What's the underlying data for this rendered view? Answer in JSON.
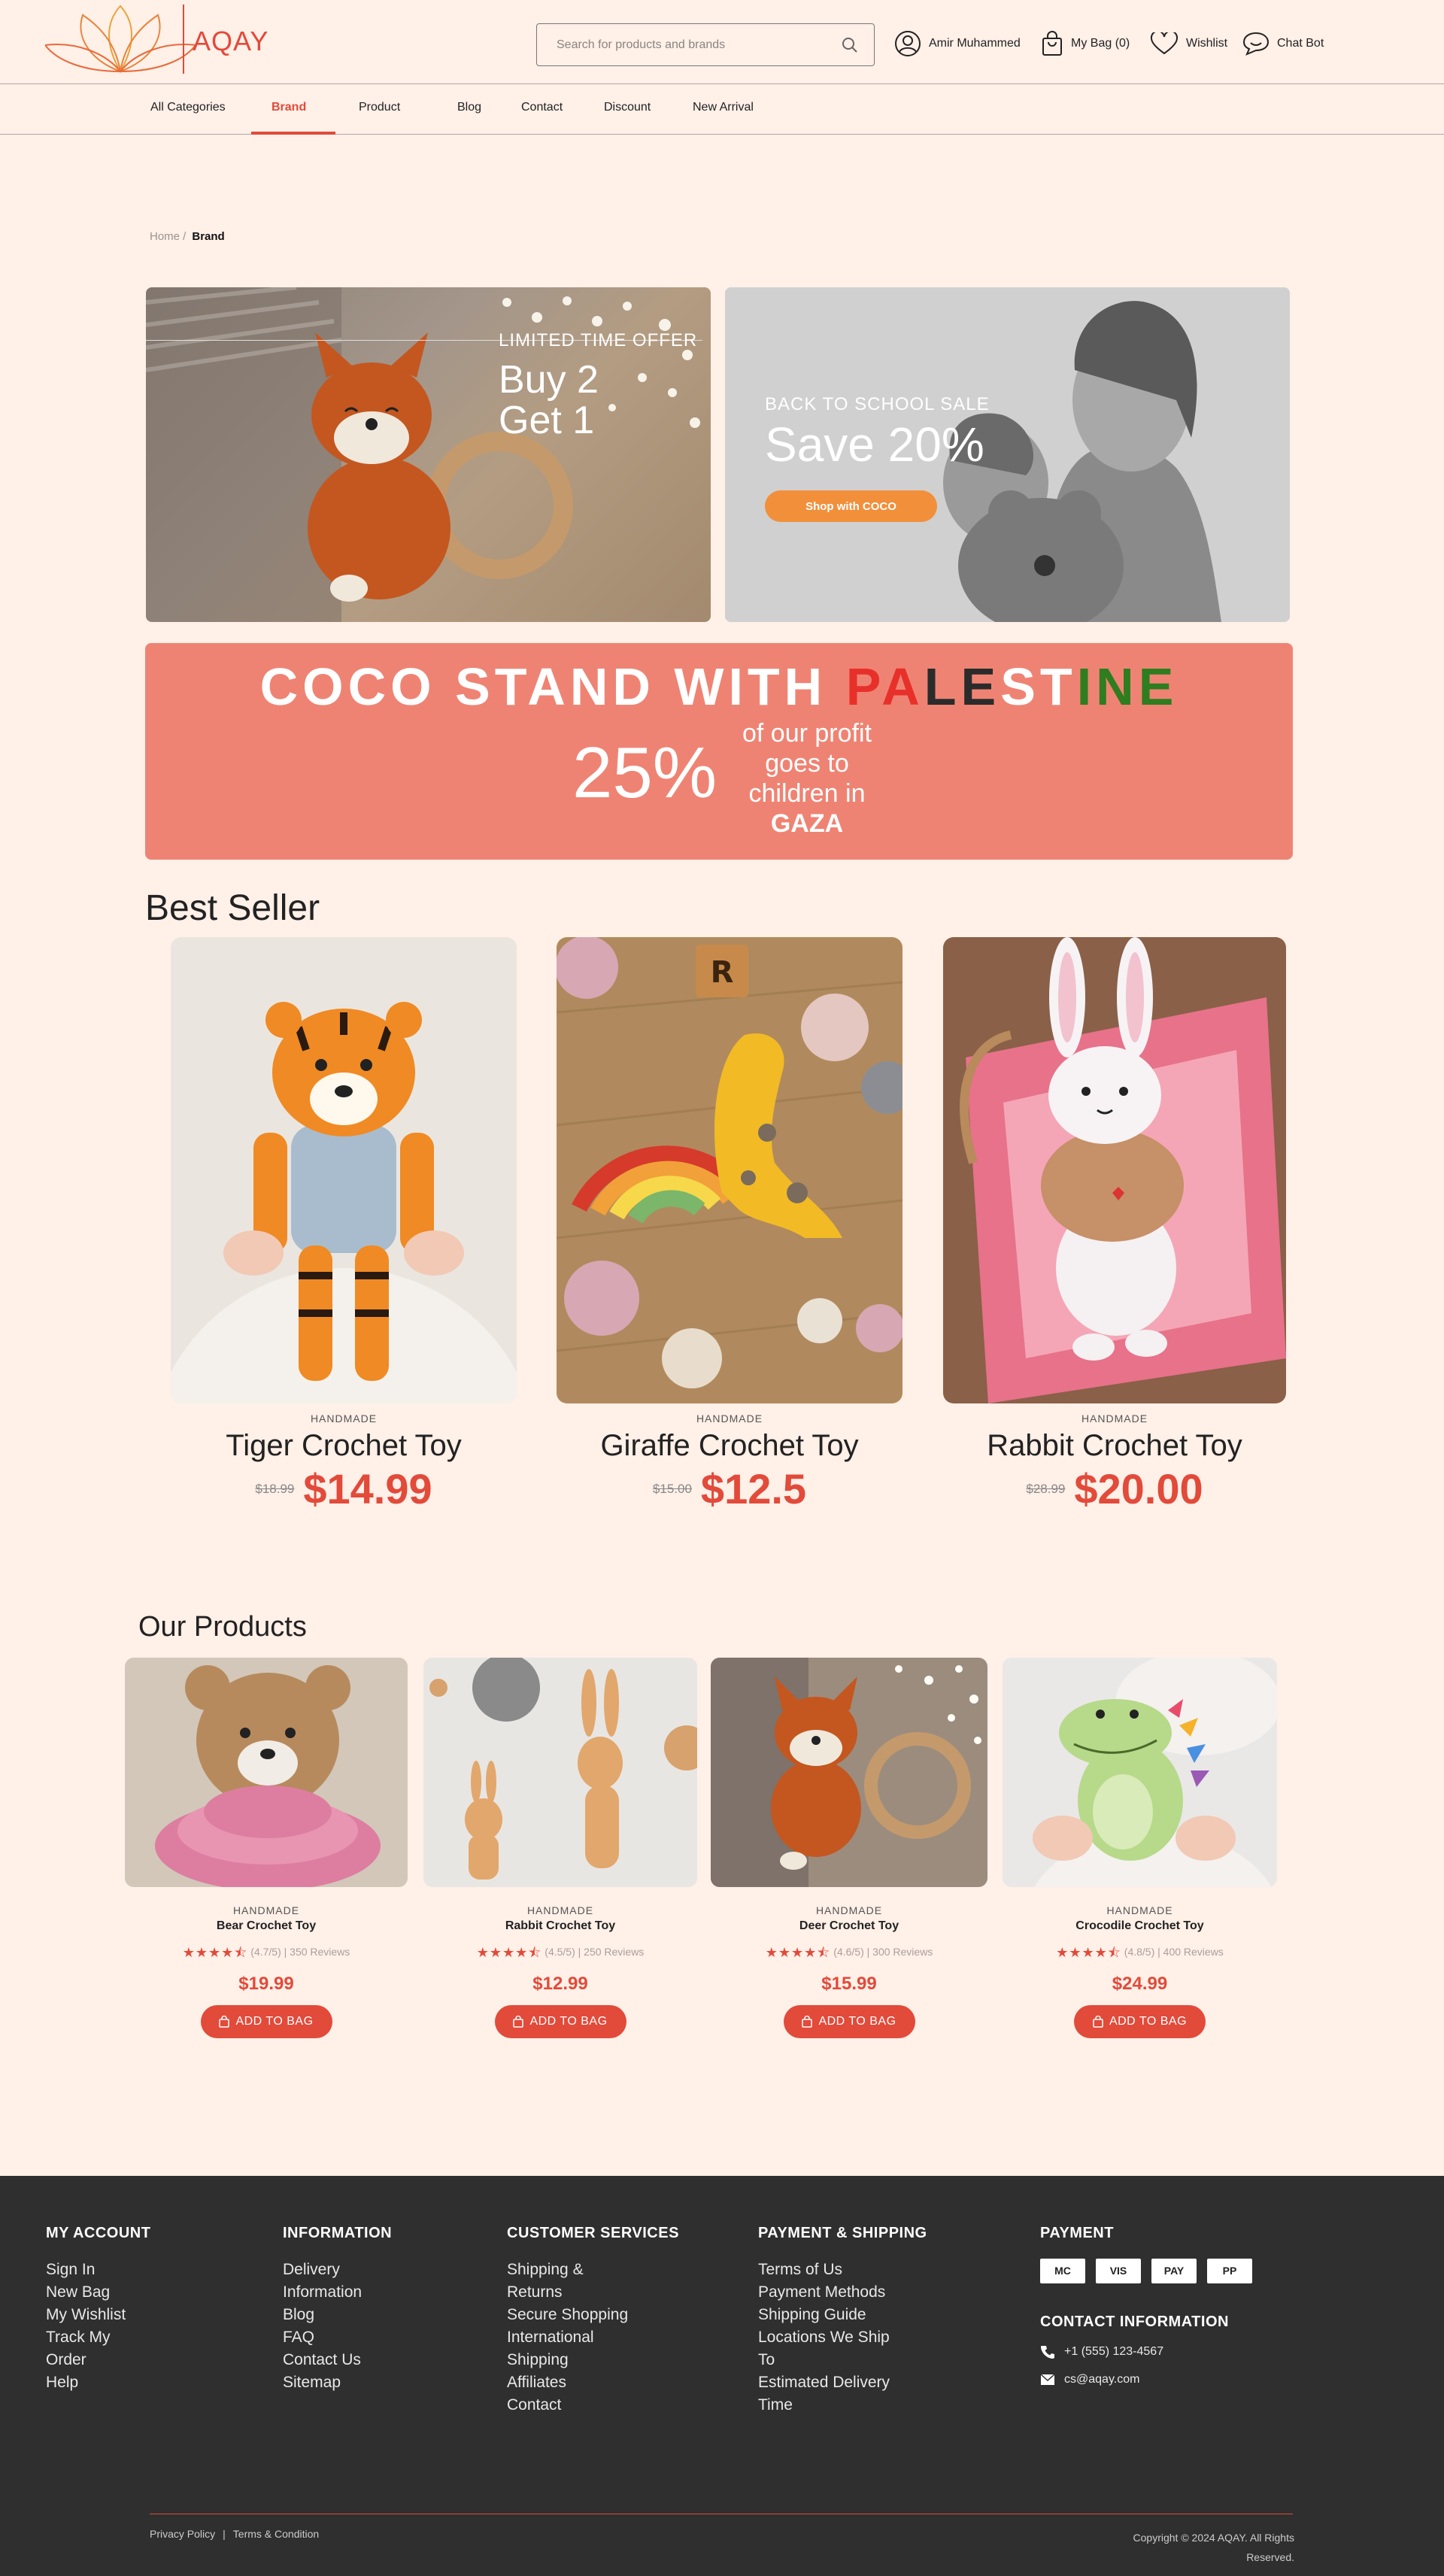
{
  "brand": {
    "name": "AQAY",
    "accent": "#e24a3a"
  },
  "header": {
    "search_placeholder": "Search for products and brands",
    "account_label": "Amir Muhammed",
    "bag_label": "My Bag (0)",
    "wishlist_label": "Wishlist",
    "chatbot_label": "Chat Bot"
  },
  "nav": {
    "items": [
      {
        "label": "All Categories"
      },
      {
        "label": "Brand",
        "active": true
      },
      {
        "label": "Product"
      },
      {
        "label": "Blog"
      },
      {
        "label": "Contact"
      },
      {
        "label": "Discount"
      },
      {
        "label": "New Arrival"
      }
    ]
  },
  "breadcrumb": {
    "home": "Home /",
    "current": "Brand"
  },
  "hero": {
    "left": {
      "eyebrow": "LIMITED TIME OFFER",
      "line1": "Buy 2",
      "line2": "Get 1"
    },
    "right": {
      "eyebrow": "BACK TO SCHOOL SALE",
      "headline": "Save 20%",
      "button": "Shop with COCO"
    }
  },
  "palestine": {
    "prefix": "COCO STAND WITH ",
    "word_letters": [
      {
        "ch": "P",
        "color": "#e8302a"
      },
      {
        "ch": "A",
        "color": "#e8302a"
      },
      {
        "ch": "L",
        "color": "#2b2b2b"
      },
      {
        "ch": "E",
        "color": "#2b2b2b"
      },
      {
        "ch": "S",
        "color": "#ffffff"
      },
      {
        "ch": "T",
        "color": "#ffffff"
      },
      {
        "ch": "I",
        "color": "#2e7d1f"
      },
      {
        "ch": "N",
        "color": "#2e7d1f"
      },
      {
        "ch": "E",
        "color": "#2e7d1f"
      }
    ],
    "percent": "25%",
    "line1": "of our profit",
    "line2": "goes to",
    "line3": "children in",
    "line4": "GAZA"
  },
  "best_seller": {
    "title": "Best Seller",
    "items": [
      {
        "tag": "HANDMADE",
        "name": "Tiger Crochet Toy",
        "old_price": "$18.99",
        "price": "$14.99",
        "icon": "tiger-toy-image"
      },
      {
        "tag": "HANDMADE",
        "name": "Giraffe Crochet Toy",
        "old_price": "$15.00",
        "price": "$12.5",
        "icon": "giraffe-toy-image"
      },
      {
        "tag": "HANDMADE",
        "name": "Rabbit Crochet Toy",
        "old_price": "$28.99",
        "price": "$20.00",
        "icon": "rabbit-toy-image"
      }
    ]
  },
  "our_products": {
    "title": "Our Products",
    "button_label": "ADD TO BAG",
    "items": [
      {
        "tag": "HANDMADE",
        "name": "Bear Crochet Toy",
        "rating": 4.5,
        "rating_text": "(4.7/5) | 350 Reviews",
        "price": "$19.99"
      },
      {
        "tag": "HANDMADE",
        "name": "Rabbit Crochet Toy",
        "rating": 4.5,
        "rating_text": "(4.5/5) | 250 Reviews",
        "price": "$12.99"
      },
      {
        "tag": "HANDMADE",
        "name": "Deer Crochet Toy",
        "rating": 4.5,
        "rating_text": "(4.6/5) | 300 Reviews",
        "price": "$15.99"
      },
      {
        "tag": "HANDMADE",
        "name": "Crocodile Crochet Toy",
        "rating": 4.5,
        "rating_text": "(4.8/5) | 400 Reviews",
        "price": "$24.99"
      }
    ]
  },
  "footer": {
    "columns": [
      {
        "title": "MY ACCOUNT",
        "items": [
          "Sign In",
          "New Bag",
          "My Wishlist",
          "Track My",
          "Order",
          "Help"
        ]
      },
      {
        "title": "INFORMATION",
        "items": [
          "Delivery",
          "Information",
          "Blog",
          "FAQ",
          "Contact Us",
          "Sitemap"
        ]
      },
      {
        "title": "CUSTOMER SERVICES",
        "items": [
          "Shipping &",
          "Returns",
          "Secure Shopping",
          "International",
          "Shipping",
          "Affiliates",
          "Contact"
        ]
      },
      {
        "title": "PAYMENT & SHIPPING",
        "items": [
          "Terms of Us",
          "Payment Methods",
          "Shipping Guide",
          "Locations We Ship",
          "To",
          "Estimated Delivery",
          "Time"
        ]
      }
    ],
    "payment": {
      "title": "PAYMENT",
      "badges": [
        "MC",
        "VIS",
        "PAY",
        "PP"
      ]
    },
    "contact": {
      "title": "CONTACT INFORMATION",
      "phone": "+1 (555) 123-4567",
      "email": "cs@aqay.com"
    },
    "bottom": {
      "privacy": "Privacy Policy",
      "separator": "|",
      "terms": "Terms & Condition",
      "copyright_line1": "Copyright © 2024 AQAY. All Rights",
      "copyright_line2": "Reserved."
    }
  }
}
